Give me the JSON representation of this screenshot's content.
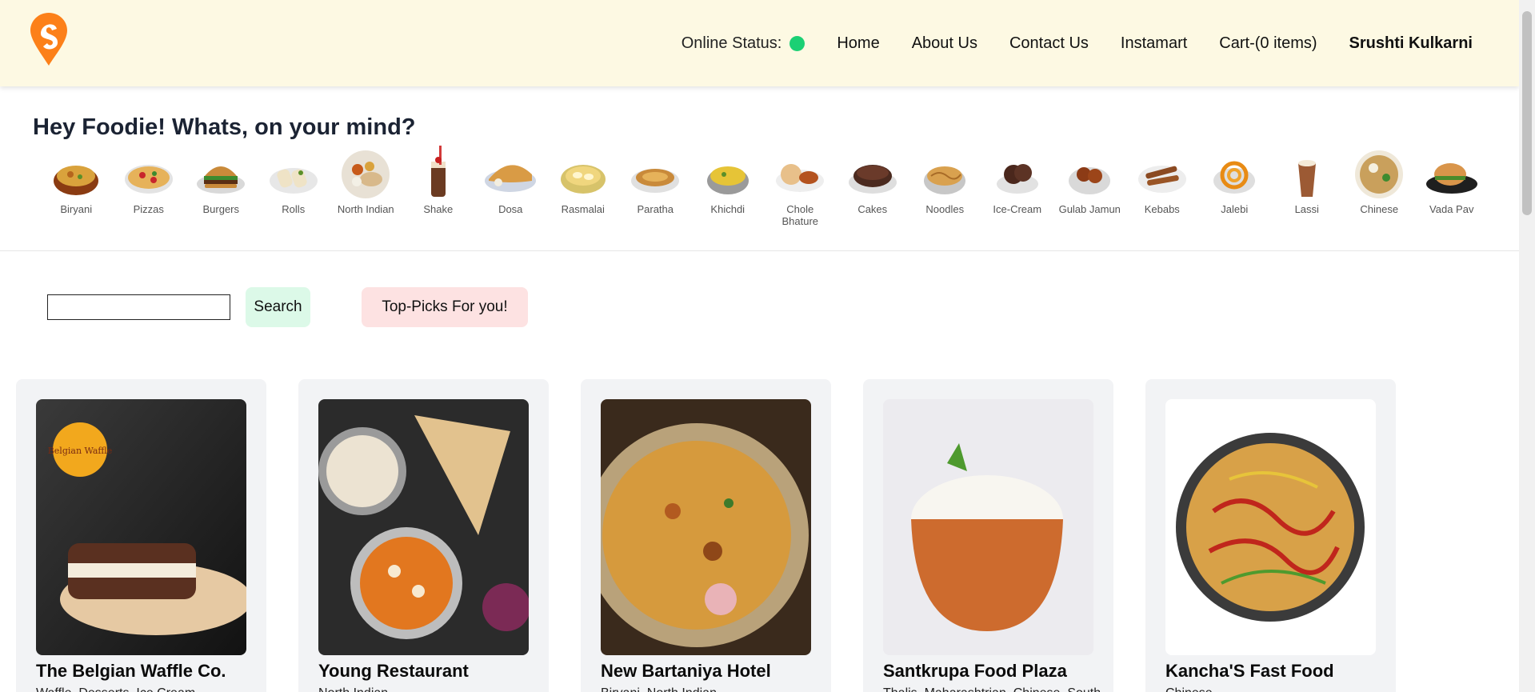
{
  "header": {
    "logo_icon": "swiggy-logo-icon",
    "status_label": "Online Status:",
    "status_color": "#1bd074",
    "nav": {
      "home": "Home",
      "about": "About Us",
      "contact": "Contact Us",
      "instamart": "Instamart",
      "cart": "Cart-(0 items)",
      "user": "Srushti Kulkarni"
    },
    "background": "#fdf9e3"
  },
  "mind": {
    "title": "Hey Foodie! Whats, on your mind?",
    "categories": [
      {
        "label": "Biryani",
        "icon": "biryani-icon"
      },
      {
        "label": "Pizzas",
        "icon": "pizza-icon"
      },
      {
        "label": "Burgers",
        "icon": "burger-icon"
      },
      {
        "label": "Rolls",
        "icon": "rolls-icon"
      },
      {
        "label": "North Indian",
        "icon": "north-indian-icon"
      },
      {
        "label": "Shake",
        "icon": "shake-icon"
      },
      {
        "label": "Dosa",
        "icon": "dosa-icon"
      },
      {
        "label": "Rasmalai",
        "icon": "rasmalai-icon"
      },
      {
        "label": "Paratha",
        "icon": "paratha-icon"
      },
      {
        "label": "Khichdi",
        "icon": "khichdi-icon"
      },
      {
        "label": "Chole Bhature",
        "icon": "chole-bhature-icon"
      },
      {
        "label": "Cakes",
        "icon": "cake-icon"
      },
      {
        "label": "Noodles",
        "icon": "noodles-icon"
      },
      {
        "label": "Ice-Cream",
        "icon": "ice-cream-icon"
      },
      {
        "label": "Gulab Jamun",
        "icon": "gulab-jamun-icon"
      },
      {
        "label": "Kebabs",
        "icon": "kebab-icon"
      },
      {
        "label": "Jalebi",
        "icon": "jalebi-icon"
      },
      {
        "label": "Lassi",
        "icon": "lassi-icon"
      },
      {
        "label": "Chinese",
        "icon": "chinese-icon"
      },
      {
        "label": "Vada Pav",
        "icon": "vada-pav-icon"
      }
    ]
  },
  "search": {
    "value": "",
    "button_label": "Search",
    "top_picks_label": "Top-Picks For you!",
    "search_button_color": "#dcf9e8",
    "top_picks_color": "#fde2e2"
  },
  "restaurants": [
    {
      "name": "The Belgian Waffle Co.",
      "cuisine": "Waffle, Desserts, Ice Cream",
      "image": "waffle-image",
      "logo_text": "The Belgian Waffle Co"
    },
    {
      "name": "Young Restaurant",
      "cuisine": "North Indian",
      "image": "north-indian-thali-image"
    },
    {
      "name": "New Bartaniya Hotel",
      "cuisine": "Biryani, North Indian",
      "image": "biryani-image"
    },
    {
      "name": "Santkrupa Food Plaza",
      "cuisine": "Thalis, Maharashtrian, Chinese, South",
      "image": "rice-bowl-image"
    },
    {
      "name": "Kancha'S Fast Food",
      "cuisine": "Chinese",
      "image": "noodles-image"
    }
  ]
}
